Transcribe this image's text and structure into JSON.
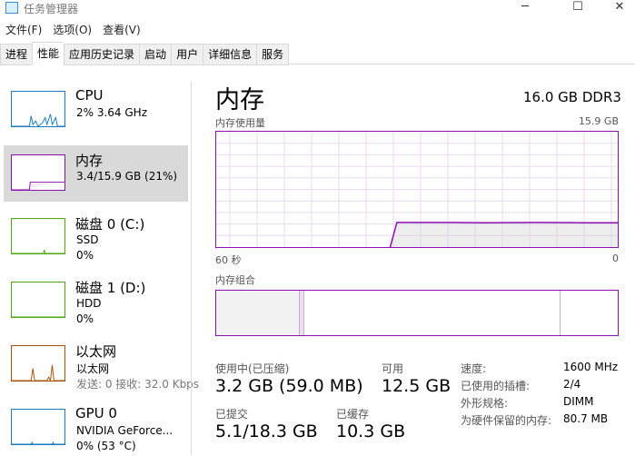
{
  "window": {
    "title": "任务管理器",
    "controls": [
      "minimize",
      "maximize",
      "close"
    ]
  },
  "menu": [
    "文件(F)",
    "选项(O)",
    "查看(V)"
  ],
  "tabs": [
    {
      "label": "进程"
    },
    {
      "label": "性能",
      "active": true
    },
    {
      "label": "应用历史记录"
    },
    {
      "label": "启动"
    },
    {
      "label": "用户"
    },
    {
      "label": "详细信息"
    },
    {
      "label": "服务"
    }
  ],
  "sidebar": [
    {
      "name": "CPU",
      "lines": [
        "2% 3.64 GHz"
      ],
      "color": "#1a7bbf"
    },
    {
      "name": "内存",
      "lines": [
        "3.4/15.9 GB (21%)"
      ],
      "color": "#8b12ae",
      "selected": true
    },
    {
      "name": "磁盘 0 (C:)",
      "lines": [
        "SSD",
        "0%"
      ],
      "color": "#4da60c"
    },
    {
      "name": "磁盘 1 (D:)",
      "lines": [
        "HDD",
        "0%"
      ],
      "color": "#4da60c"
    },
    {
      "name": "以太网",
      "lines": [
        "以太网",
        "发送: 0 接收: 32.0 Kbps"
      ],
      "color": "#a74f01"
    },
    {
      "name": "GPU 0",
      "lines": [
        "NVIDIA GeForce...",
        "0% (53 °C)"
      ],
      "color": "#1a7bbf"
    }
  ],
  "main": {
    "title": "内存",
    "spec": "16.0 GB DDR3",
    "usage_label": "内存使用量",
    "usage_max": "15.9 GB",
    "time_left": "60 秒",
    "time_right": "0",
    "composition_label": "内存组合",
    "stats": [
      {
        "label": "使用中(已压缩)",
        "value": "3.2 GB (59.0 MB)"
      },
      {
        "label": "可用",
        "value": "12.5 GB"
      },
      {
        "label": "已提交",
        "value": "5.1/18.3 GB"
      },
      {
        "label": "已缓存",
        "value": "10.3 GB"
      }
    ],
    "details": [
      {
        "label": "速度:",
        "value": "1600 MHz"
      },
      {
        "label": "已使用的插槽:",
        "value": "2/4"
      },
      {
        "label": "外形规格:",
        "value": "DIMM"
      },
      {
        "label": "为硬件保留的内存:",
        "value": "80.7 MB"
      }
    ]
  },
  "chart_data": {
    "type": "area",
    "xlabel_left": "60 秒",
    "xlabel_right": "0",
    "ylim": [
      0,
      15.9
    ],
    "unit": "GB",
    "color": "#8b12ae",
    "grid": true,
    "x": [
      34,
      33,
      25,
      20,
      12,
      5,
      0
    ],
    "y": [
      0,
      3.4,
      3.4,
      3.35,
      3.4,
      3.35,
      3.35
    ]
  }
}
